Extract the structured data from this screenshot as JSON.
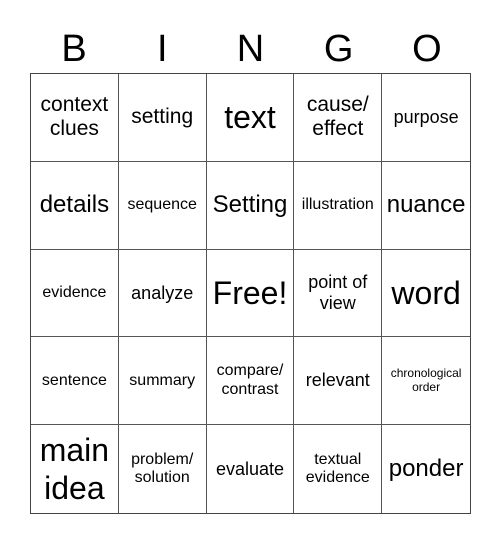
{
  "header": {
    "letters": [
      "B",
      "I",
      "N",
      "G",
      "O"
    ]
  },
  "cells": [
    {
      "text": "context clues",
      "size": "s-l"
    },
    {
      "text": "setting",
      "size": "s-l"
    },
    {
      "text": "text",
      "size": "s-xxl"
    },
    {
      "text": "cause/ effect",
      "size": "s-l"
    },
    {
      "text": "purpose",
      "size": "s-m"
    },
    {
      "text": "details",
      "size": "s-xl"
    },
    {
      "text": "sequence",
      "size": "s-s"
    },
    {
      "text": "Setting",
      "size": "s-xl"
    },
    {
      "text": "illustration",
      "size": "s-s"
    },
    {
      "text": "nuance",
      "size": "s-xl"
    },
    {
      "text": "evidence",
      "size": "s-s"
    },
    {
      "text": "analyze",
      "size": "s-m"
    },
    {
      "text": "Free!",
      "size": "s-xxl"
    },
    {
      "text": "point of view",
      "size": "s-m"
    },
    {
      "text": "word",
      "size": "s-xxl"
    },
    {
      "text": "sentence",
      "size": "s-s"
    },
    {
      "text": "summary",
      "size": "s-s"
    },
    {
      "text": "compare/ contrast",
      "size": "s-s"
    },
    {
      "text": "relevant",
      "size": "s-m"
    },
    {
      "text": "chronological order",
      "size": "s-xs"
    },
    {
      "text": "main idea",
      "size": "s-xxl"
    },
    {
      "text": "problem/ solution",
      "size": "s-s"
    },
    {
      "text": "evaluate",
      "size": "s-m"
    },
    {
      "text": "textual evidence",
      "size": "s-s"
    },
    {
      "text": "ponder",
      "size": "s-xl"
    }
  ]
}
